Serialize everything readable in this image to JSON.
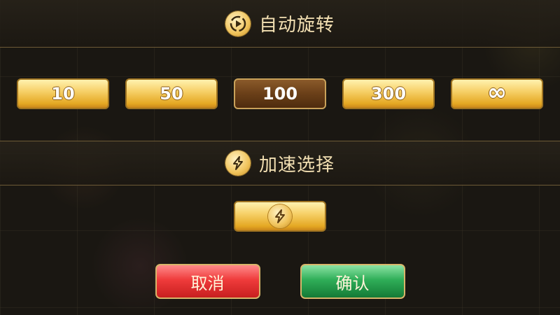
{
  "auto_spin": {
    "title": "自动旋转",
    "title_icon": "auto-play-icon",
    "options": [
      "10",
      "50",
      "100",
      "300",
      "∞"
    ],
    "selected": "100"
  },
  "turbo": {
    "title": "加速选择",
    "title_icon": "lightning-icon",
    "toggle_icon": "lightning-icon"
  },
  "actions": {
    "cancel_label": "取消",
    "confirm_label": "确认"
  },
  "colors": {
    "gold": "#f7d16a",
    "selected_brown": "#6a3f18",
    "cancel_red": "#ef3b3b",
    "confirm_green": "#2fae58",
    "title_text": "#f2dfb2"
  }
}
